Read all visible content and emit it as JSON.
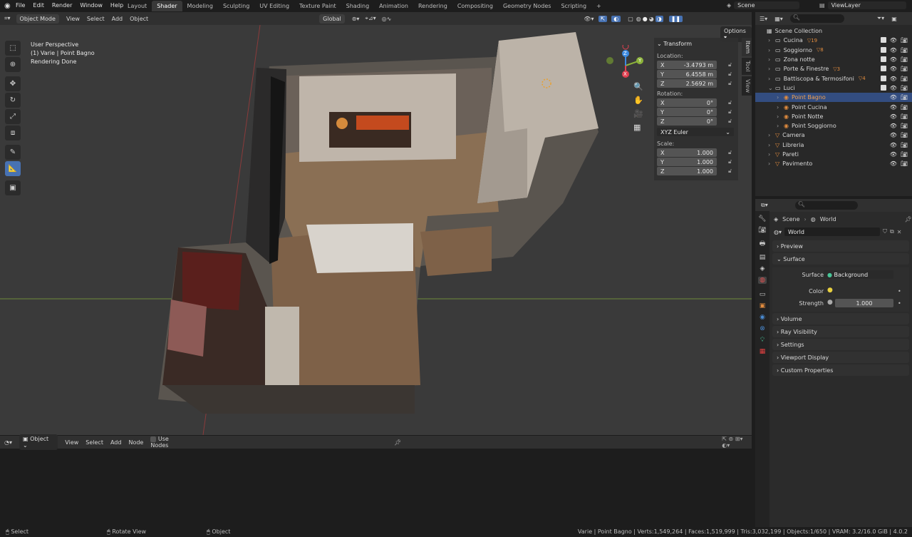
{
  "menu": [
    "File",
    "Edit",
    "Render",
    "Window",
    "Help"
  ],
  "workspaces": [
    "Layout",
    "Shader",
    "Modeling",
    "Sculpting",
    "UV Editing",
    "Texture Paint",
    "Shading",
    "Animation",
    "Rendering",
    "Compositing",
    "Geometry Nodes",
    "Scripting"
  ],
  "active_workspace": "Shader",
  "scene": "Scene",
  "viewlayer": "ViewLayer",
  "viewport": {
    "mode": "Object Mode",
    "view": "View",
    "select": "Select",
    "add": "Add",
    "object": "Object",
    "orientation": "Global",
    "options": "Options",
    "overlay_text": [
      "User Perspective",
      "(1) Varie | Point Bagno",
      "Rendering Done"
    ]
  },
  "npanel": {
    "title": "Transform",
    "location_label": "Location:",
    "rotation_label": "Rotation:",
    "scale_label": "Scale:",
    "location": [
      {
        "axis": "X",
        "value": "-3.4793 m"
      },
      {
        "axis": "Y",
        "value": "6.4558 m"
      },
      {
        "axis": "Z",
        "value": "2.5692 m"
      }
    ],
    "rotation": [
      {
        "axis": "X",
        "value": "0°"
      },
      {
        "axis": "Y",
        "value": "0°"
      },
      {
        "axis": "Z",
        "value": "0°"
      }
    ],
    "rotation_mode": "XYZ Euler",
    "scale": [
      {
        "axis": "X",
        "value": "1.000"
      },
      {
        "axis": "Y",
        "value": "1.000"
      },
      {
        "axis": "Z",
        "value": "1.000"
      }
    ],
    "tabs": [
      "Item",
      "Tool",
      "View"
    ]
  },
  "gizmo": {
    "x": "X",
    "y": "Y",
    "z": "Z"
  },
  "outliner": {
    "root": "Scene Collection",
    "items": [
      {
        "label": "Cucina",
        "indent": 1,
        "color": "#d8d8d8",
        "selected": false,
        "extra": "19"
      },
      {
        "label": "Soggiorno",
        "indent": 1,
        "color": "#d8d8d8",
        "selected": false,
        "extra": "8"
      },
      {
        "label": "Zona notte",
        "indent": 1,
        "color": "#d8d8d8",
        "selected": false,
        "extra": ""
      },
      {
        "label": "Porte & Finestre",
        "indent": 1,
        "color": "#d8d8d8",
        "selected": false,
        "extra": "3"
      },
      {
        "label": "Battiscopa & Termosifoni",
        "indent": 1,
        "color": "#d8d8d8",
        "selected": false,
        "extra": "4"
      },
      {
        "label": "Luci",
        "indent": 1,
        "color": "#d8d8d8",
        "selected": false,
        "extra": ""
      },
      {
        "label": "Point Bagno",
        "indent": 2,
        "color": "#f0a050",
        "selected": true,
        "extra": ""
      },
      {
        "label": "Point Cucina",
        "indent": 2,
        "color": "#d8d8d8",
        "selected": false,
        "extra": ""
      },
      {
        "label": "Point Notte",
        "indent": 2,
        "color": "#d8d8d8",
        "selected": false,
        "extra": ""
      },
      {
        "label": "Point Soggiorno",
        "indent": 2,
        "color": "#d8d8d8",
        "selected": false,
        "extra": ""
      },
      {
        "label": "Camera",
        "indent": 1,
        "color": "#d8d8d8",
        "selected": false,
        "extra": ""
      },
      {
        "label": "Libreria",
        "indent": 1,
        "color": "#d8d8d8",
        "selected": false,
        "extra": ""
      },
      {
        "label": "Pareti",
        "indent": 1,
        "color": "#d8d8d8",
        "selected": false,
        "extra": ""
      },
      {
        "label": "Pavimento",
        "indent": 1,
        "color": "#d8d8d8",
        "selected": false,
        "extra": ""
      }
    ]
  },
  "properties": {
    "breadcrumb_scene": "Scene",
    "breadcrumb_world": "World",
    "world_name": "World",
    "sections": [
      "Preview",
      "Surface",
      "Volume",
      "Ray Visibility",
      "Settings",
      "Viewport Display",
      "Custom Properties"
    ],
    "surface_label": "Surface",
    "surface_value": "Background",
    "color_label": "Color",
    "strength_label": "Strength",
    "strength_value": "1.000"
  },
  "node_editor": {
    "type": "Object",
    "view": "View",
    "select": "Select",
    "add": "Add",
    "node": "Node",
    "use_nodes": "Use Nodes"
  },
  "status": {
    "select": "Select",
    "rotate": "Rotate View",
    "object": "Object",
    "info": "Varie | Point Bagno | Verts:1,549,264 | Faces:1,519,999 | Tris:3,032,199 | Objects:1/650 | VRAM: 3.2/16.0 GiB | 4.0.2"
  }
}
